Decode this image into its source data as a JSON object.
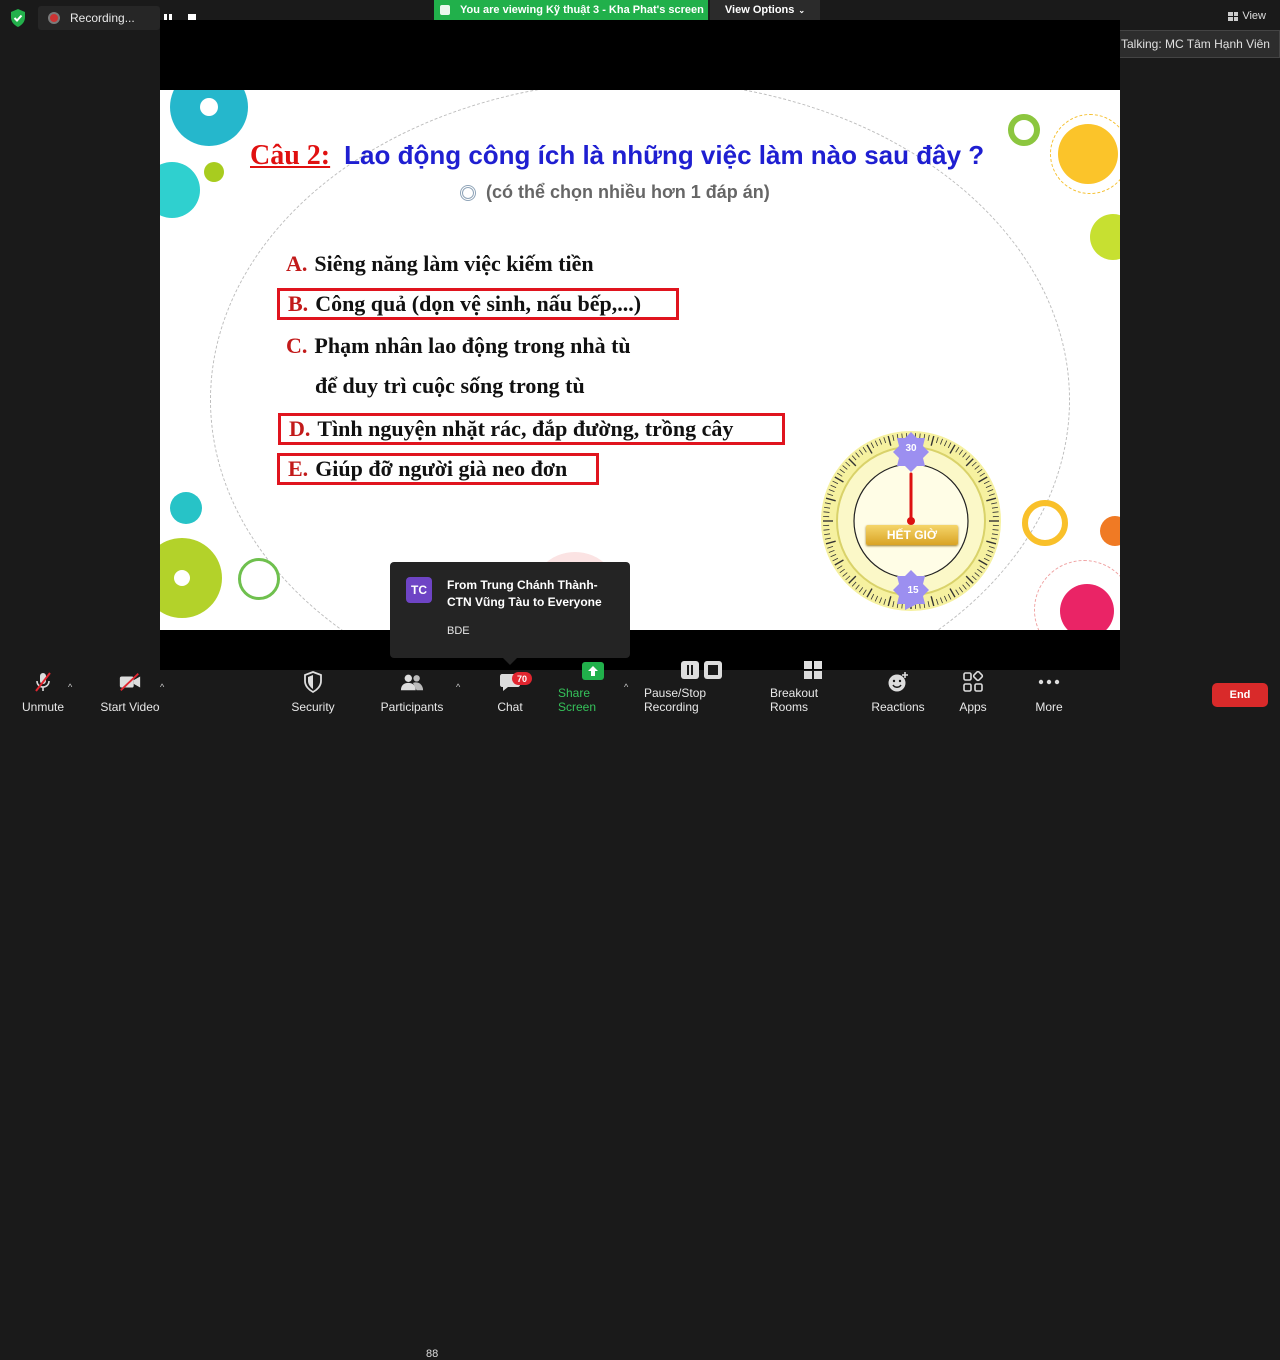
{
  "top": {
    "recording_label": "Recording...",
    "viewing_text": "You are viewing Kỹ thuật 3 - Kha Phat's screen",
    "view_options": "View Options",
    "view_label": "View",
    "talking_text": "Talking: MC Tâm Hạnh Viên"
  },
  "slide": {
    "question_number": "Câu 2:",
    "question_text": "Lao động công ích là những việc làm nào sau đây ?",
    "subtitle": "(có thể chọn nhiều hơn 1 đáp án)",
    "answers": [
      {
        "letter": "A.",
        "text": "Siêng năng làm việc kiếm tiền",
        "boxed": false
      },
      {
        "letter": "B.",
        "text": "Công quả (dọn vệ sinh, nấu bếp,...)",
        "boxed": true
      },
      {
        "letter": "C.",
        "text": "Phạm nhân lao động trong nhà tù",
        "boxed": false
      },
      {
        "letter": "",
        "text": "để duy trì cuộc sống trong tù",
        "boxed": false
      },
      {
        "letter": "D.",
        "text": "Tình nguyện nhặt rác, đắp đường, trồng cây",
        "boxed": true
      },
      {
        "letter": "E.",
        "text": "Giúp đỡ người già neo đơn",
        "boxed": true
      }
    ],
    "timer": {
      "top_mark": "30",
      "bottom_mark": "15",
      "label": "HẾT GIỜ"
    }
  },
  "chat_popup": {
    "avatar_initials": "TC",
    "from": "From Trung Chánh Thành-CTN Vũng Tàu to Everyone",
    "message": "BDE"
  },
  "toolbar": {
    "unmute": "Unmute",
    "start_video": "Start Video",
    "security": "Security",
    "participants": "Participants",
    "participants_count": "88",
    "chat": "Chat",
    "chat_badge": "70",
    "share_screen": "Share Screen",
    "pause_stop": "Pause/Stop Recording",
    "breakout": "Breakout Rooms",
    "reactions": "Reactions",
    "apps": "Apps",
    "more": "More",
    "end": "End"
  },
  "colors": {
    "share_green": "#21b04b",
    "end_red": "#d92a2a",
    "question_blue": "#1f1fd1",
    "question_red": "#e01010",
    "box_red": "#e0141e"
  }
}
